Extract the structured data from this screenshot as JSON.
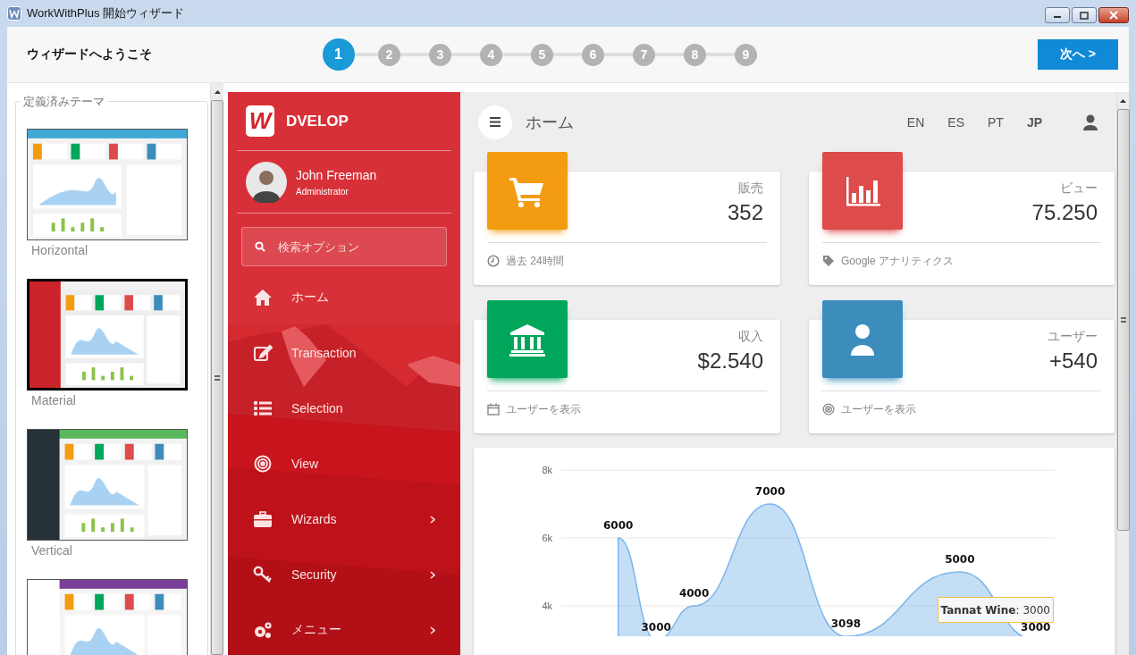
{
  "window": {
    "title": "WorkWithPlus 開始ウィザード"
  },
  "wizard": {
    "heading": "ウィザードへようこそ",
    "next_button": "次へ >",
    "steps": [
      {
        "label": "1",
        "selected": true
      },
      {
        "label": "2",
        "selected": false
      },
      {
        "label": "3",
        "selected": false
      },
      {
        "label": "4",
        "selected": false
      },
      {
        "label": "5",
        "selected": false
      },
      {
        "label": "6",
        "selected": false
      },
      {
        "label": "7",
        "selected": false
      },
      {
        "label": "8",
        "selected": false
      },
      {
        "label": "9",
        "selected": false
      }
    ]
  },
  "themes": {
    "legend": "定義済みテーマ",
    "items": [
      {
        "kind": "horizontal",
        "label": "Horizontal",
        "selected": false
      },
      {
        "kind": "material",
        "label": "Material",
        "selected": true
      },
      {
        "kind": "vertical",
        "label": "Vertical",
        "selected": false
      },
      {
        "kind": "compact",
        "selected": false
      }
    ]
  },
  "sidebar": {
    "logo_letter": "W",
    "brand": "DVELOP",
    "user_name": "John Freeman",
    "user_role": "Administrator",
    "search_placeholder": "検索オプション",
    "menu": [
      {
        "kind": "home",
        "label": "ホーム",
        "submenu": false
      },
      {
        "kind": "edit",
        "label": "Transaction",
        "submenu": false
      },
      {
        "kind": "list",
        "label": "Selection",
        "submenu": false
      },
      {
        "kind": "target",
        "label": "View",
        "submenu": false
      },
      {
        "kind": "briefcase",
        "label": "Wizards",
        "submenu": true
      },
      {
        "kind": "key",
        "label": "Security",
        "submenu": true
      },
      {
        "kind": "gears",
        "label": "メニュー",
        "submenu": true
      }
    ]
  },
  "topbar": {
    "title": "ホーム",
    "languages": [
      {
        "label": "EN",
        "selected": false
      },
      {
        "label": "ES",
        "selected": false
      },
      {
        "label": "PT",
        "selected": false
      },
      {
        "label": "JP",
        "selected": true
      }
    ]
  },
  "cards": [
    {
      "kind": "cart",
      "color": "#f39c12",
      "label": "販売",
      "value": "352",
      "footer": "過去 24時間"
    },
    {
      "kind": "chart",
      "color": "#dd4b4b",
      "label": "ビュー",
      "value": "75.250",
      "footer": "Google アナリティクス"
    },
    {
      "kind": "bank",
      "color": "#00a65a",
      "label": "収入",
      "value": "$2.540",
      "footer": "ユーザーを表示"
    },
    {
      "kind": "user",
      "color": "#3c8dbc",
      "label": "ユーザー",
      "value": "+540",
      "footer": "ユーザーを表示"
    }
  ],
  "chart": {
    "chart_data": {
      "type": "area",
      "series": [
        {
          "name": "Tannat Wine",
          "color": "#7cb5ec",
          "values": [
            null,
            6000,
            3000,
            4000,
            null,
            7000,
            null,
            3098,
            null,
            null,
            5000,
            null,
            3000
          ]
        }
      ],
      "ylim": [
        0,
        8000
      ],
      "yticks": [
        {
          "value": 4000,
          "label": "4k"
        },
        {
          "value": 6000,
          "label": "6k"
        },
        {
          "value": 8000,
          "label": "8k"
        }
      ],
      "value_labels": [
        "6000",
        "3000",
        "4000",
        "7000",
        "3098",
        "5000",
        "3000"
      ]
    },
    "tooltip": {
      "separator": ":",
      "value": "3000"
    }
  }
}
